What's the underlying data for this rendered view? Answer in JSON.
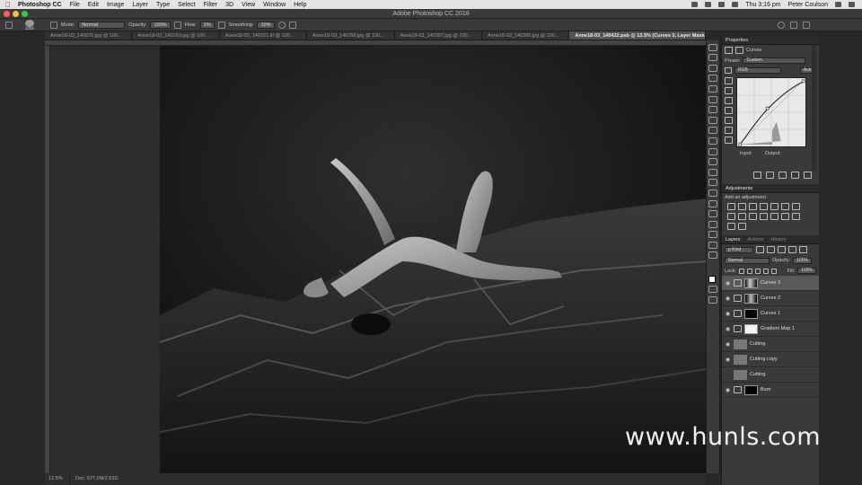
{
  "menubar": {
    "apple": "",
    "app_name": "Photoshop CC",
    "items": [
      "File",
      "Edit",
      "Image",
      "Layer",
      "Type",
      "Select",
      "Filter",
      "3D",
      "View",
      "Window",
      "Help"
    ],
    "clock": "Thu 3:16 pm",
    "user": "Peter Coulson"
  },
  "window": {
    "title": "Adobe Photoshop CC 2018"
  },
  "options": {
    "brush_size": "1000",
    "mode_label": "Mode:",
    "mode_value": "Normal",
    "opacity_label": "Opacity:",
    "opacity_value": "100%",
    "flow_label": "Flow:",
    "flow_value": "1%",
    "smoothing_label": "Smoothing:",
    "smoothing_value": "10%"
  },
  "tabs": [
    {
      "label": "Anne18-03_140070.jpg @ 100..."
    },
    {
      "label": "Anne18-03_140163.jpg @ 100..."
    },
    {
      "label": "Anne18-03_140321.tif @ 100..."
    },
    {
      "label": "Anne18-03_140158.jpg @ 100..."
    },
    {
      "label": "Anne18-03_140387.jpg @ 100..."
    },
    {
      "label": "Anne18-03_140395.jpg @ 100..."
    },
    {
      "label": "Anne18-03_140422.psb @ 12.5% (Curves 3, Layer Mask/..."
    }
  ],
  "status": {
    "zoom": "12.5%",
    "doc": "Doc: 577.0M/2.52G"
  },
  "properties": {
    "header": "Properties",
    "type": "Curves",
    "preset_label": "Preset:",
    "preset_value": "Custom",
    "channel_value": "RGB",
    "auto_label": "Auto",
    "input_label": "Input:",
    "output_label": "Output:"
  },
  "adjustments": {
    "header": "Adjustments",
    "subtitle": "Add an adjustment"
  },
  "layers": {
    "tabs": [
      "Layers",
      "Actions",
      "History"
    ],
    "kind_value": "ρ Kind",
    "blend_value": "Normal",
    "opacity_label": "Opacity:",
    "opacity_value": "100%",
    "lock_label": "Lock:",
    "fill_label": "Fill:",
    "fill_value": "100%",
    "items": [
      {
        "name": "Curves 3",
        "selected": true
      },
      {
        "name": "Curves 2",
        "selected": false
      },
      {
        "name": "Curves 1",
        "selected": false
      },
      {
        "name": "Gradient Map 1",
        "selected": false
      },
      {
        "name": "Cutting",
        "selected": false
      },
      {
        "name": "Cutting copy",
        "selected": false
      },
      {
        "name": "Cutting",
        "selected": false
      },
      {
        "name": "Burn",
        "selected": false
      }
    ]
  },
  "watermark": "www.hunls.com",
  "colors": {
    "accent": "#595959",
    "panel": "#3a3a3a",
    "menubar": "#e4e4e4"
  }
}
